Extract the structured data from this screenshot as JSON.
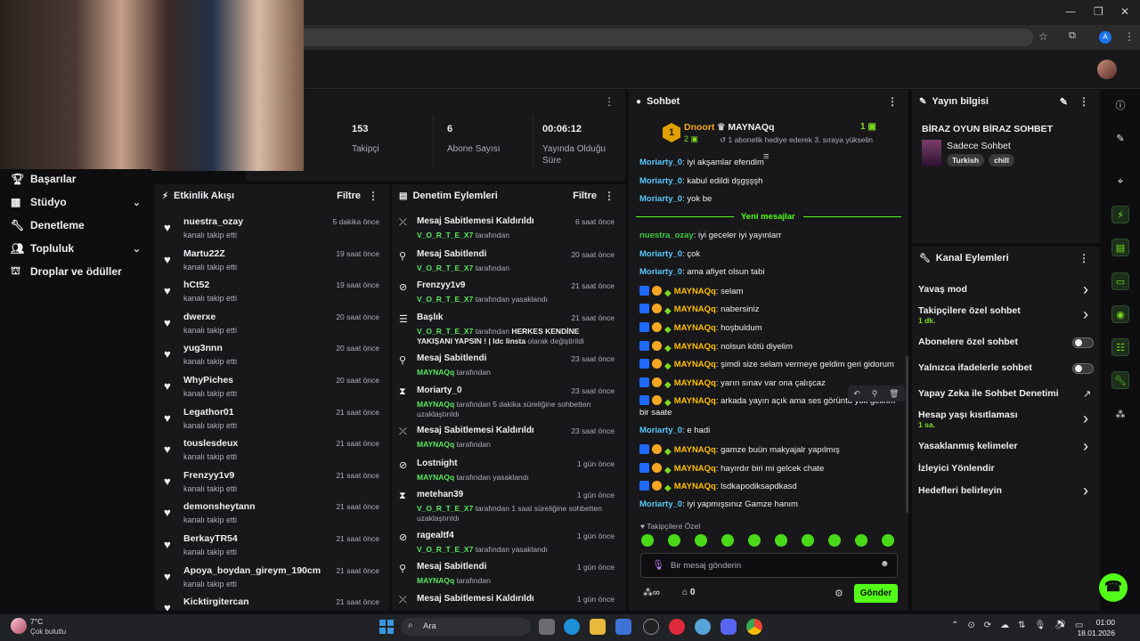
{
  "stats": [
    {
      "value": "153",
      "label": "Takipçi"
    },
    {
      "value": "6",
      "label": "Abone Sayısı"
    },
    {
      "value": "00:06:12",
      "label": "Yayında Olduğu Süre"
    }
  ],
  "sidebar": {
    "items": [
      {
        "label": "Başarılar",
        "icon": "trophy-icon"
      },
      {
        "label": "Stüdyo",
        "icon": "film-icon"
      },
      {
        "label": "Denetleme",
        "icon": "wrench-icon"
      },
      {
        "label": "Topluluk",
        "icon": "people-icon"
      },
      {
        "label": "Droplar ve ödüller",
        "icon": "gift-icon"
      }
    ]
  },
  "activity": {
    "title": "Etkinlik Akışı",
    "filter": "Filtre",
    "items": [
      {
        "name": "nuestra_ozay",
        "sub": "kanalı takip etti",
        "time": "5 dakika önce"
      },
      {
        "name": "Martu22Z",
        "sub": "kanalı takip etti",
        "time": "19 saat önce"
      },
      {
        "name": "hCt52",
        "sub": "kanalı takip etti",
        "time": "19 saat önce"
      },
      {
        "name": "dwerxe",
        "sub": "kanalı takip etti",
        "time": "20 saat önce"
      },
      {
        "name": "yug3nnn",
        "sub": "kanalı takip etti",
        "time": "20 saat önce"
      },
      {
        "name": "WhyPiches",
        "sub": "kanalı takip etti",
        "time": "20 saat önce"
      },
      {
        "name": "Legathor01",
        "sub": "kanalı takip etti",
        "time": "21 saat önce"
      },
      {
        "name": "touslesdeux",
        "sub": "kanalı takip etti",
        "time": "21 saat önce"
      },
      {
        "name": "Frenzyy1v9",
        "sub": "kanalı takip etti",
        "time": "21 saat önce"
      },
      {
        "name": "demonsheytann",
        "sub": "kanalı takip etti",
        "time": "21 saat önce"
      },
      {
        "name": "BerkayTR54",
        "sub": "kanalı takip etti",
        "time": "21 saat önce"
      },
      {
        "name": "Apoya_boydan_gireym_190cm",
        "sub": "kanalı takip etti",
        "time": "21 saat önce"
      },
      {
        "name": "Kicktirgitercan",
        "sub": "",
        "time": "21 saat önce"
      }
    ]
  },
  "modlog": {
    "title": "Denetim Eylemleri",
    "filter": "Filtre",
    "items": [
      {
        "title": "Mesaj Sabitlemesi Kaldırıldı",
        "user": "V_O_R_T_E_X7",
        "rest": " tarafından",
        "extra": "",
        "extra2": "",
        "time": "6 saat önce",
        "icon": "unpin-icon"
      },
      {
        "title": "Mesaj Sabitlendi",
        "user": "V_O_R_T_E_X7",
        "rest": " tarafından",
        "extra": "",
        "extra2": "",
        "time": "20 saat önce",
        "icon": "pin-icon"
      },
      {
        "title": "Frenzyy1v9",
        "user": "V_O_R_T_E_X7",
        "rest": " tarafından yasaklandı",
        "extra": "",
        "extra2": "",
        "time": "21 saat önce",
        "icon": "ban-icon"
      },
      {
        "title": "Başlık",
        "user": "V_O_R_T_E_X7",
        "rest": " tarafından ",
        "extra": "HERKES KENDİNE YAKIŞANI YAPSIN ! | Idc linsta",
        "extra2": " olarak değiştirildi",
        "time": "21 saat önce",
        "icon": "title-icon"
      },
      {
        "title": "Mesaj Sabitlendi",
        "user": "MAYNAQq",
        "rest": " tarafından",
        "extra": "",
        "extra2": "",
        "time": "23 saat önce",
        "icon": "pin-icon"
      },
      {
        "title": "Moriarty_0",
        "user": "MAYNAQq",
        "rest": " tarafından 5 dakika süreliğine sohbetten uzaklaştırıldı",
        "extra": "",
        "extra2": "",
        "time": "23 saat önce",
        "icon": "hourglass-icon"
      },
      {
        "title": "Mesaj Sabitlemesi Kaldırıldı",
        "user": "MAYNAQq",
        "rest": " tarafından",
        "extra": "",
        "extra2": "",
        "time": "23 saat önce",
        "icon": "unpin-icon"
      },
      {
        "title": "Lostnight",
        "user": "MAYNAQq",
        "rest": " tarafından yasaklandı",
        "extra": "",
        "extra2": "",
        "time": "1 gün önce",
        "icon": "ban-icon"
      },
      {
        "title": "metehan39",
        "user": "V_O_R_T_E_X7",
        "rest": " tarafından 1 saat süreliğine sohbetten uzaklaştırıldı",
        "extra": "",
        "extra2": "",
        "time": "1 gün önce",
        "icon": "hourglass-icon"
      },
      {
        "title": "ragealtf4",
        "user": "V_O_R_T_E_X7",
        "rest": " tarafından yasaklandı",
        "extra": "",
        "extra2": "",
        "time": "1 gün önce",
        "icon": "ban-icon"
      },
      {
        "title": "Mesaj Sabitlendi",
        "user": "MAYNAQq",
        "rest": " tarafından",
        "extra": "",
        "extra2": "",
        "time": "1 gün önce",
        "icon": "pin-icon"
      },
      {
        "title": "Mesaj Sabitlemesi Kaldırıldı",
        "user": "",
        "rest": "",
        "extra": "",
        "extra2": "",
        "time": "1 gün önce",
        "icon": "unpin-icon"
      }
    ]
  },
  "chat": {
    "title": "Sohbet",
    "leader": {
      "rank": "1",
      "name": "Dnoort",
      "gifts": "2",
      "gifter": "MAYNAQq",
      "gifter_count": "1",
      "gifter_msg": "1 abonelik hediye ederek 3. sıraya yükselin"
    },
    "new_messages": "Yeni mesajlar",
    "lines_before": [
      {
        "user": "Moriarty_0",
        "msg": "iyi akşamlar efendim"
      },
      {
        "user": "Moriarty_0",
        "msg": "kabul edildi dşgşşşh"
      },
      {
        "user": "Moriarty_0",
        "msg": "yok be"
      }
    ],
    "lines_after": [
      {
        "user": "nuestra_ozay",
        "msg": "iyi geceler iyi yayınlarr",
        "kind": "g"
      },
      {
        "user": "Moriarty_0",
        "msg": "çok",
        "kind": "b"
      },
      {
        "user": "Moriarty_0",
        "msg": "ama afiyet olsun tabi",
        "kind": "b"
      },
      {
        "user": "MAYNAQq",
        "msg": "selam",
        "kind": "y"
      },
      {
        "user": "MAYNAQq",
        "msg": "nabersiniz",
        "kind": "y"
      },
      {
        "user": "MAYNAQq",
        "msg": "hoşbuldum",
        "kind": "y"
      },
      {
        "user": "MAYNAQq",
        "msg": "nolsun kötü diyelim",
        "kind": "y"
      },
      {
        "user": "MAYNAQq",
        "msg": "şimdi size selam vermeye geldim geri gidorum",
        "kind": "y"
      },
      {
        "user": "MAYNAQq",
        "msg": "yarın sınav var ona çalışcaz",
        "kind": "y"
      },
      {
        "user": "MAYNAQq",
        "msg": "arkada yayın açık ama ses görüntü yok gelirim",
        "kind": "y",
        "cont": "bir saate"
      },
      {
        "user": "Moriarty_0",
        "msg": "e hadi",
        "kind": "b"
      },
      {
        "user": "MAYNAQq",
        "msg": "gamze buün makyajalr yapılmış",
        "kind": "y"
      },
      {
        "user": "MAYNAQq",
        "msg": "hayırdır biri mi gelcek chate",
        "kind": "y"
      },
      {
        "user": "MAYNAQq",
        "msg": "lsdkapodiksapdkasd",
        "kind": "y"
      },
      {
        "user": "Moriarty_0",
        "msg": "iyi yapmışsınız Gamze hanım",
        "kind": "b"
      }
    ],
    "followers_only": "Takipçilere Özel",
    "placeholder": "Bir mesaj gönderin",
    "points": "0",
    "send": "Gönder"
  },
  "stream_info": {
    "title": "Yayın bilgisi",
    "stream_title": "BİRAZ OYUN BİRAZ SOHBET",
    "category": "Sadece Sohbet",
    "tags": [
      "Turkish",
      "chill"
    ]
  },
  "channel_actions": {
    "title": "Kanal Eylemleri",
    "items": [
      {
        "label": "Yavaş mod",
        "sub": "",
        "control": "arrow"
      },
      {
        "label": "Takipçilere özel sohbet",
        "sub": "1 dk.",
        "control": "arrow"
      },
      {
        "label": "Abonelere özel sohbet",
        "sub": "",
        "control": "toggle"
      },
      {
        "label": "Yalnızca ifadelerle sohbet",
        "sub": "",
        "control": "toggle"
      },
      {
        "label": "Yapay Zeka ile Sohbet Denetimi",
        "sub": "",
        "control": "external"
      },
      {
        "label": "Hesap yaşı kısıtlaması",
        "sub": "1 sa.",
        "control": "arrow"
      },
      {
        "label": "Yasaklanmış kelimeler",
        "sub": "",
        "control": "arrow"
      },
      {
        "label": "İzleyici Yönlendir",
        "sub": "",
        "control": "none"
      },
      {
        "label": "Hedefleri belirleyin",
        "sub": "",
        "control": "arrow"
      }
    ]
  },
  "taskbar": {
    "weather_temp": "7°C",
    "weather_desc": "Çok bulutlu",
    "search": "Ara",
    "time": "01:00",
    "date": "18.01.2026"
  },
  "colors": {
    "accent": "#53fc18",
    "panel": "#18181b",
    "background": "#0e0e10"
  }
}
